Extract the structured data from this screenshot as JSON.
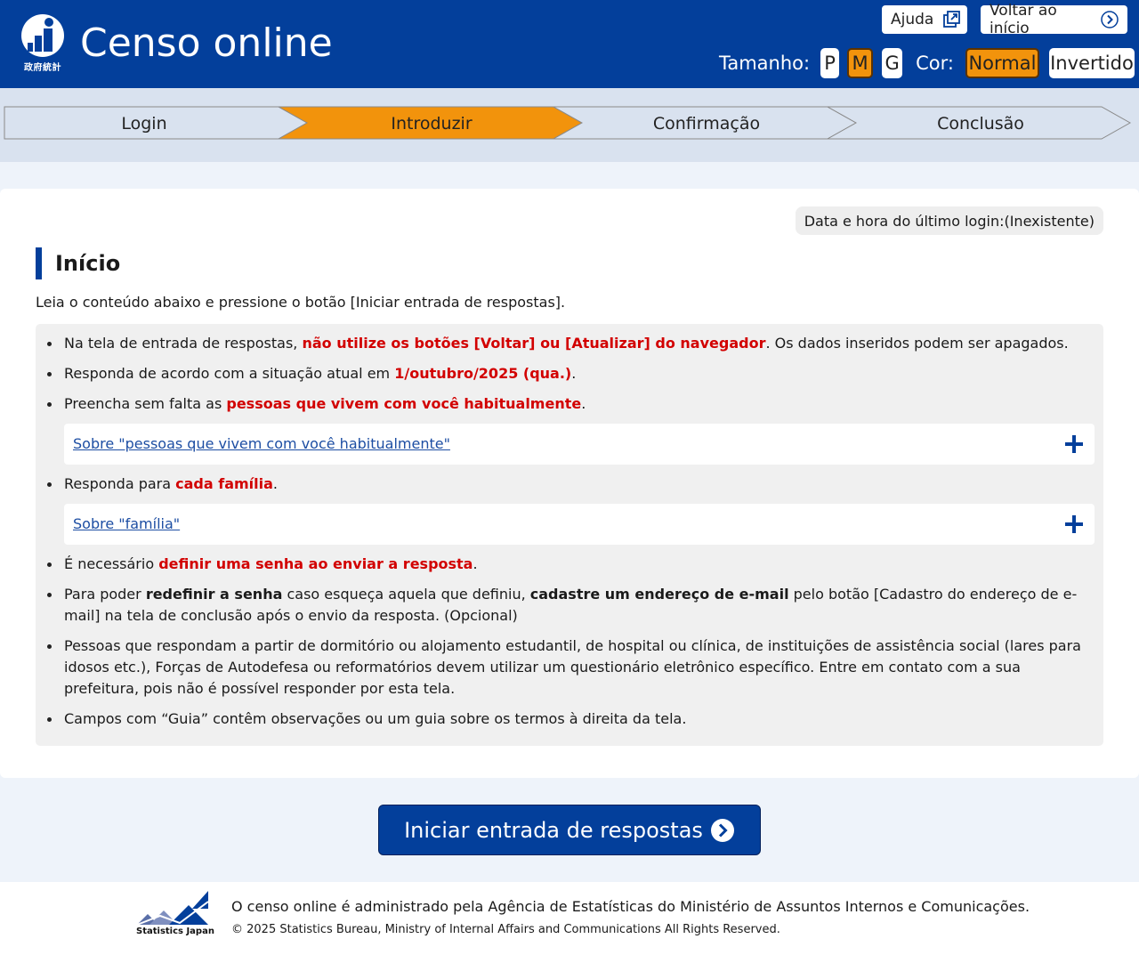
{
  "header": {
    "logo_text": "政府統計",
    "title": "Censo online",
    "help_label": "Ajuda",
    "home_label": "Voltar ao início",
    "size_label": "Tamanho:",
    "size_options": [
      "P",
      "M",
      "G"
    ],
    "size_selected": "M",
    "color_label": "Cor:",
    "color_options": [
      "Normal",
      "Invertido"
    ],
    "color_selected": "Normal"
  },
  "steps": {
    "items": [
      "Login",
      "Introduzir",
      "Confirmação",
      "Conclusão"
    ],
    "current": "Introduzir",
    "colors": {
      "current": "#f2930c",
      "other": "#d9e2ef"
    }
  },
  "main": {
    "last_login": "Data e hora do último login:(Inexistente)",
    "title": "Início",
    "intro": "Leia o conteúdo abaixo e pressione o botão [Iniciar entrada de respostas].",
    "notes": {
      "n1_a": "Na tela de entrada de respostas, ",
      "n1_b": "não utilize os botões [Voltar] ou [Atualizar] do navegador",
      "n1_c": ". Os dados inseridos podem ser apagados.",
      "n2_a": "Responda de acordo com a situação atual em ",
      "n2_b": "1/outubro/2025 (qua.)",
      "n2_c": ".",
      "n3_a": "Preencha sem falta as ",
      "n3_b": "pessoas que vivem com você habitualmente",
      "n3_c": ".",
      "acc1": "Sobre \"pessoas que vivem com você habitualmente\"",
      "n4_a": "Responda para ",
      "n4_b": "cada família",
      "n4_c": ".",
      "acc2": "Sobre \"família\"",
      "n5_a": "É necessário ",
      "n5_b": "definir uma senha ao enviar a resposta",
      "n5_c": ".",
      "n6_a": "Para poder ",
      "n6_b": "redefinir a senha",
      "n6_c": " caso esqueça aquela que definiu, ",
      "n6_d": "cadastre um endereço de e-mail",
      "n6_e": " pelo botão [Cadastro do endereço de e-mail] na tela de conclusão após o envio da resposta. (Opcional)",
      "n7": "Pessoas que respondam a partir de dormitório ou alojamento estudantil, de hospital ou clínica, de instituições de assistência social (lares para idosos etc.), Forças de Autodefesa ou reformatórios devem utilizar um questionário eletrônico específico. Entre em contato com a sua prefeitura, pois não é possível responder por esta tela.",
      "n8": "Campos com “Guia” contêm observações ou um guia sobre os termos à direita da tela."
    }
  },
  "cta": {
    "label": "Iniciar entrada de respostas"
  },
  "footer": {
    "logo_text": "Statistics Japan",
    "text": "O censo online é administrado pela Agência de Estatísticas do Ministério de Assuntos Internos e Comunicações.",
    "copyright": "© 2025 Statistics Bureau, Ministry of Internal Affairs and Communications All Rights Reserved."
  },
  "icons": [
    "logo-icon",
    "external-link-icon",
    "chevron-right-icon",
    "plus-icon",
    "statistics-japan-logo-icon"
  ],
  "colors": {
    "brand": "#033f9b",
    "accent": "#f2930c",
    "warning": "#d20000",
    "link": "#1d4ea3"
  }
}
